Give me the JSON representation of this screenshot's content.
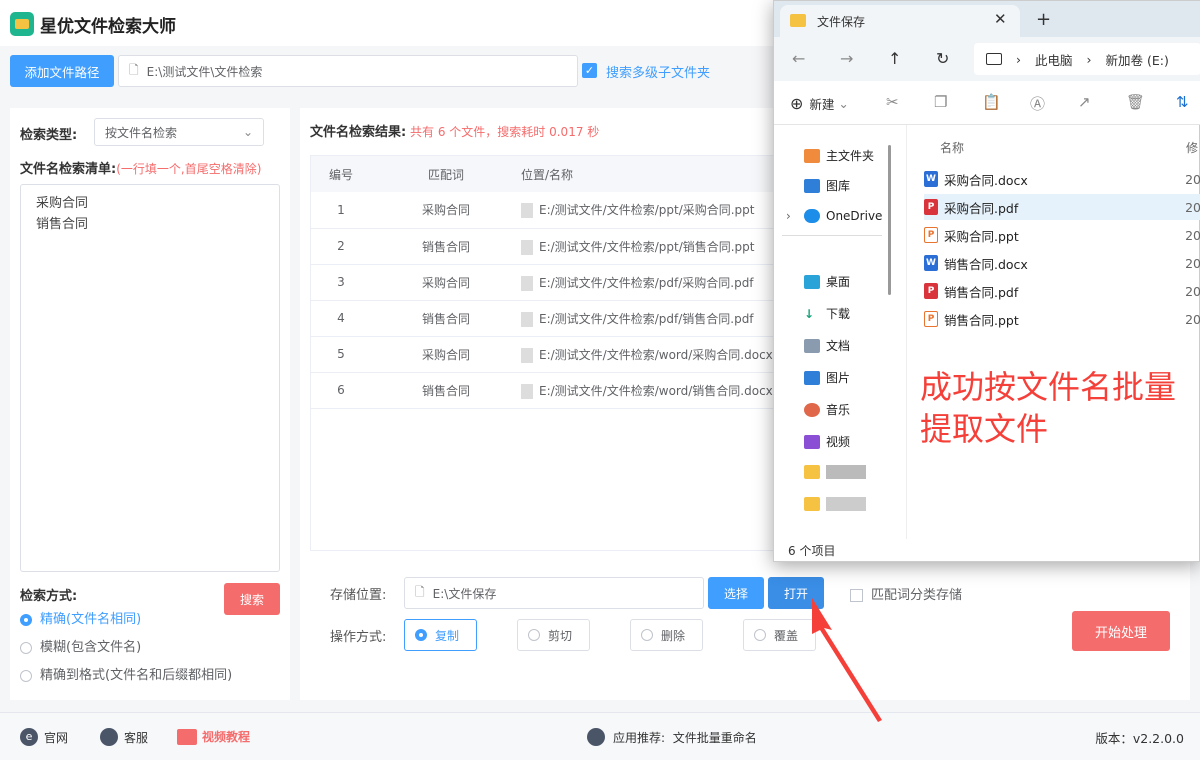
{
  "app": {
    "title": "星优文件检索大师",
    "add_path_label": "添加文件路径",
    "path_value": "E:\\测试文件\\文件检索",
    "subfolder_label": "搜索多级子文件夹",
    "subfolder_checked": true
  },
  "left": {
    "search_type_label": "检索类型:",
    "search_type_value": "按文件名检索",
    "list_label": "文件名检索清单:",
    "list_hint": "(一行填一个,首尾空格清除)",
    "list_items": [
      "采购合同",
      "销售合同"
    ],
    "mode_label": "检索方式:",
    "search_button": "搜索",
    "modes": [
      {
        "label": "精确(文件名相同)",
        "selected": true
      },
      {
        "label": "模糊(包含文件名)",
        "selected": false
      },
      {
        "label": "精确到格式(文件名和后缀都相同)",
        "selected": false
      }
    ]
  },
  "results": {
    "label": "文件名检索结果:",
    "summary": "共有 6 个文件，搜索耗时 0.017 秒",
    "columns": [
      "编号",
      "匹配词",
      "位置/名称"
    ],
    "rows": [
      {
        "no": "1",
        "word": "采购合同",
        "path": "E:/测试文件/文件检索/ppt/采购合同.ppt"
      },
      {
        "no": "2",
        "word": "销售合同",
        "path": "E:/测试文件/文件检索/ppt/销售合同.ppt"
      },
      {
        "no": "3",
        "word": "采购合同",
        "path": "E:/测试文件/文件检索/pdf/采购合同.pdf"
      },
      {
        "no": "4",
        "word": "销售合同",
        "path": "E:/测试文件/文件检索/pdf/销售合同.pdf"
      },
      {
        "no": "5",
        "word": "采购合同",
        "path": "E:/测试文件/文件检索/word/采购合同.docx"
      },
      {
        "no": "6",
        "word": "销售合同",
        "path": "E:/测试文件/文件检索/word/销售合同.docx"
      }
    ]
  },
  "output": {
    "save_label": "存储位置:",
    "save_value": "E:\\文件保存",
    "choose_button": "选择",
    "open_button": "打开",
    "classify_label": "匹配词分类存储",
    "op_label": "操作方式:",
    "ops": [
      {
        "label": "复制",
        "selected": true
      },
      {
        "label": "剪切",
        "selected": false
      },
      {
        "label": "删除",
        "selected": false
      },
      {
        "label": "覆盖",
        "selected": false
      }
    ],
    "start_button": "开始处理"
  },
  "footer": {
    "website": "官网",
    "support": "客服",
    "video": "视频教程",
    "recommend_label": "应用推荐:",
    "recommend_app": "文件批量重命名",
    "version": "版本：v2.2.0.0"
  },
  "explorer": {
    "tab_title": "文件保存",
    "breadcrumb": [
      "此电脑",
      "新加卷 (E:)"
    ],
    "new_label": "新建",
    "column_name": "名称",
    "column_modified": "修",
    "side": [
      "主文件夹",
      "图库",
      "OneDrive",
      "桌面",
      "下载",
      "文档",
      "图片",
      "音乐",
      "视频"
    ],
    "files": [
      {
        "name": "采购合同.docx",
        "type": "word",
        "date": "20"
      },
      {
        "name": "采购合同.pdf",
        "type": "pdf",
        "date": "20"
      },
      {
        "name": "采购合同.ppt",
        "type": "ppt",
        "date": "20"
      },
      {
        "name": "销售合同.docx",
        "type": "word",
        "date": "20"
      },
      {
        "name": "销售合同.pdf",
        "type": "pdf",
        "date": "20"
      },
      {
        "name": "销售合同.ppt",
        "type": "ppt",
        "date": "20"
      }
    ],
    "status": "6 个项目"
  },
  "annotation": {
    "line1": "成功按文件名批量",
    "line2": "提取文件",
    "color": "#f5403a"
  },
  "colors": {
    "primary": "#409eff",
    "danger": "#f56c6c"
  }
}
